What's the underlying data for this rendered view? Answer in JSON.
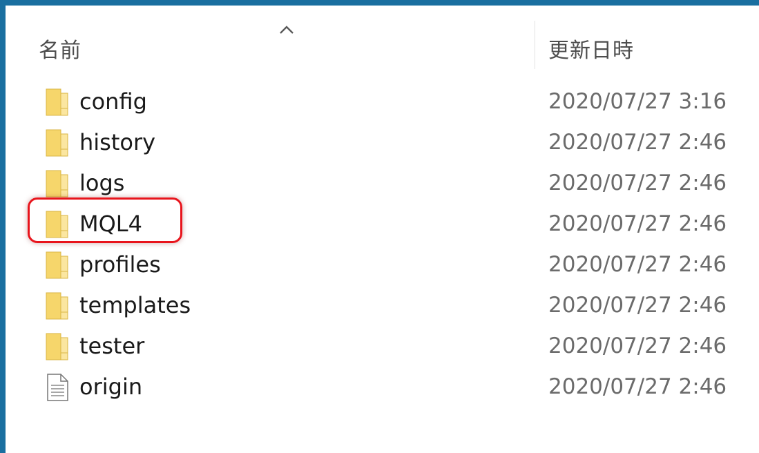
{
  "header": {
    "name_label": "名前",
    "date_label": "更新日時",
    "sort_icon": "chevron-up-icon"
  },
  "files": [
    {
      "name": "config",
      "date": "2020/07/27 3:16",
      "type": "folder",
      "icon": "folder-icon"
    },
    {
      "name": "history",
      "date": "2020/07/27 2:46",
      "type": "folder",
      "icon": "folder-icon"
    },
    {
      "name": "logs",
      "date": "2020/07/27 2:46",
      "type": "folder",
      "icon": "folder-icon"
    },
    {
      "name": "MQL4",
      "date": "2020/07/27 2:46",
      "type": "folder",
      "icon": "folder-icon",
      "highlighted": true
    },
    {
      "name": "profiles",
      "date": "2020/07/27 2:46",
      "type": "folder",
      "icon": "folder-icon"
    },
    {
      "name": "templates",
      "date": "2020/07/27 2:46",
      "type": "folder",
      "icon": "folder-icon"
    },
    {
      "name": "tester",
      "date": "2020/07/27 2:46",
      "type": "folder",
      "icon": "folder-icon"
    },
    {
      "name": "origin",
      "date": "2020/07/27 2:46",
      "type": "file",
      "icon": "document-icon"
    }
  ],
  "colors": {
    "window_frame": "#1a6fa0",
    "highlight": "#e8141c",
    "folder": "#f6d66b"
  }
}
